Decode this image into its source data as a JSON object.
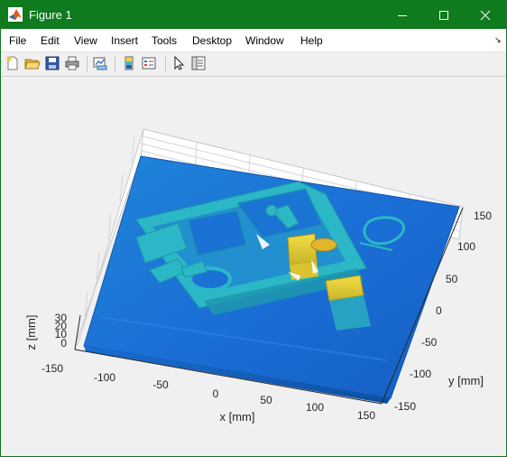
{
  "window": {
    "title": "Figure 1",
    "controls": {
      "minimize": "minimize-icon",
      "maximize": "maximize-icon",
      "close": "close-icon"
    }
  },
  "menu": {
    "items": [
      "File",
      "Edit",
      "View",
      "Insert",
      "Tools",
      "Desktop",
      "Window",
      "Help"
    ],
    "overflow_icon": "arrow-icon"
  },
  "toolbar": {
    "tools": [
      "new-figure-icon",
      "open-file-icon",
      "save-icon",
      "print-icon",
      "link-plot-icon",
      "insert-colorbar-icon",
      "insert-legend-icon",
      "pointer-icon",
      "property-editor-icon"
    ]
  },
  "plot": {
    "x_ticks": [
      "-150",
      "-100",
      "-50",
      "0",
      "50",
      "100",
      "150"
    ],
    "y_ticks": [
      "-150",
      "-100",
      "-50",
      "0",
      "50",
      "100",
      "150"
    ],
    "z_ticks": [
      "0",
      "10",
      "20",
      "30"
    ],
    "xlabel": "x [mm]",
    "ylabel": "y [mm]",
    "zlabel": "z [mm]",
    "colors": {
      "base": "#1b6fd6",
      "raised": "#2bb7c6",
      "top": "#e7d23a",
      "grid": "#d4d4d4"
    }
  }
}
